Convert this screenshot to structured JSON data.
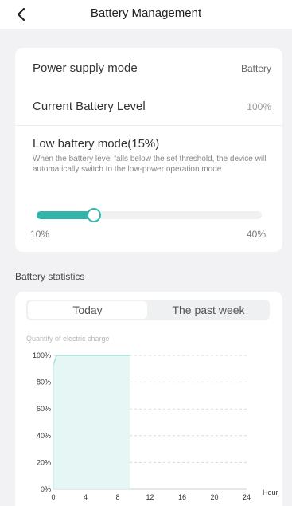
{
  "header": {
    "title": "Battery Management",
    "back_icon": "chevron-left-icon"
  },
  "settings": {
    "power_supply_label": "Power supply mode",
    "power_supply_value": "Battery",
    "battery_level_label": "Current Battery Level",
    "battery_level_value": "100%",
    "low_battery_label": "Low battery mode(15%)",
    "low_battery_desc": "When the battery level falls below the set threshold, the device will automatically switch to the low-power operation mode",
    "slider": {
      "min_label": "10%",
      "max_label": "40%",
      "min": 10,
      "max": 40,
      "value": 15
    }
  },
  "stats": {
    "section_title": "Battery statistics",
    "tabs": [
      {
        "label": "Today",
        "active": true
      },
      {
        "label": "The past week",
        "active": false
      }
    ],
    "chart_caption": "Quantity of electric charge"
  },
  "colors": {
    "accent": "#34b5aa",
    "area": "#e6f6f4"
  },
  "chart_data": {
    "type": "area",
    "title": "",
    "ylabel": "Quantity of electric charge",
    "xlabel": "Hour",
    "x_ticks": [
      0,
      4,
      8,
      12,
      16,
      20,
      24
    ],
    "y_ticks": [
      "100%",
      "80%",
      "60%",
      "40%",
      "20%",
      "0%"
    ],
    "xlim": [
      0,
      24
    ],
    "ylim": [
      0,
      100
    ],
    "grid": true,
    "series": [
      {
        "x": [
          0,
          0.4,
          9.5
        ],
        "y": [
          93,
          100,
          100
        ]
      }
    ]
  }
}
